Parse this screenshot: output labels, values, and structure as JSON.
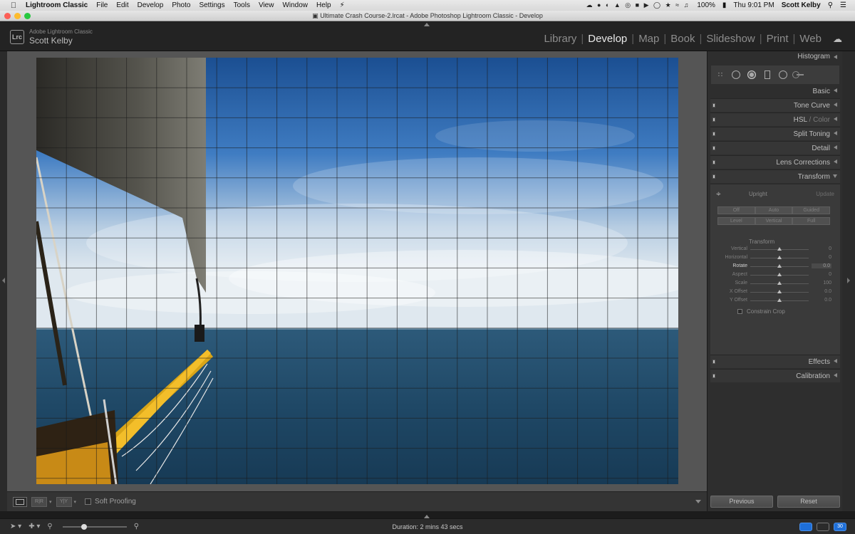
{
  "menubar": {
    "app": "Lightroom Classic",
    "items": [
      "File",
      "Edit",
      "Develop",
      "Photo",
      "Settings",
      "Tools",
      "View",
      "Window",
      "Help"
    ],
    "battery": "100%",
    "clock": "Thu 9:01 PM",
    "user": "Scott Kelby"
  },
  "window": {
    "title": "Ultimate Crash Course-2.lrcat - Adobe Photoshop Lightroom Classic - Develop"
  },
  "identity": {
    "logo": "Lrc",
    "product": "Adobe Lightroom Classic",
    "name": "Scott Kelby"
  },
  "modules": {
    "items": [
      "Library",
      "Develop",
      "Map",
      "Book",
      "Slideshow",
      "Print",
      "Web"
    ],
    "active": "Develop"
  },
  "toolbar": {
    "compare1": "R|R",
    "compare2": "Y|Y",
    "soft_proofing": "Soft Proofing"
  },
  "panel": {
    "histogram": "Histogram",
    "basic": "Basic",
    "tone_curve": "Tone Curve",
    "hsl": "HSL",
    "hsl_sep": " / ",
    "color": "Color",
    "split_toning": "Split Toning",
    "detail": "Detail",
    "lens_corrections": "Lens Corrections",
    "transform": "Transform",
    "effects": "Effects",
    "calibration": "Calibration"
  },
  "transform": {
    "upright": "Upright",
    "update": "Update",
    "buttons_row1": [
      "Off",
      "Auto",
      "Guided"
    ],
    "buttons_row2": [
      "Level",
      "Vertical",
      "Full"
    ],
    "subheading": "Transform",
    "sliders": [
      {
        "label": "Vertical",
        "value": "0",
        "pos": 0.5
      },
      {
        "label": "Horizontal",
        "value": "0",
        "pos": 0.5
      },
      {
        "label": "Rotate",
        "value": "0.0",
        "pos": 0.5,
        "active": true
      },
      {
        "label": "Aspect",
        "value": "0",
        "pos": 0.5
      },
      {
        "label": "Scale",
        "value": "100",
        "pos": 0.5
      },
      {
        "label": "X Offset",
        "value": "0.0",
        "pos": 0.5
      },
      {
        "label": "Y Offset",
        "value": "0.0",
        "pos": 0.5
      }
    ],
    "constrain_crop": "Constrain Crop"
  },
  "buttons": {
    "previous": "Previous",
    "reset": "Reset"
  },
  "status": {
    "duration": "Duration: 2 mins 43 secs",
    "badge": "30"
  }
}
